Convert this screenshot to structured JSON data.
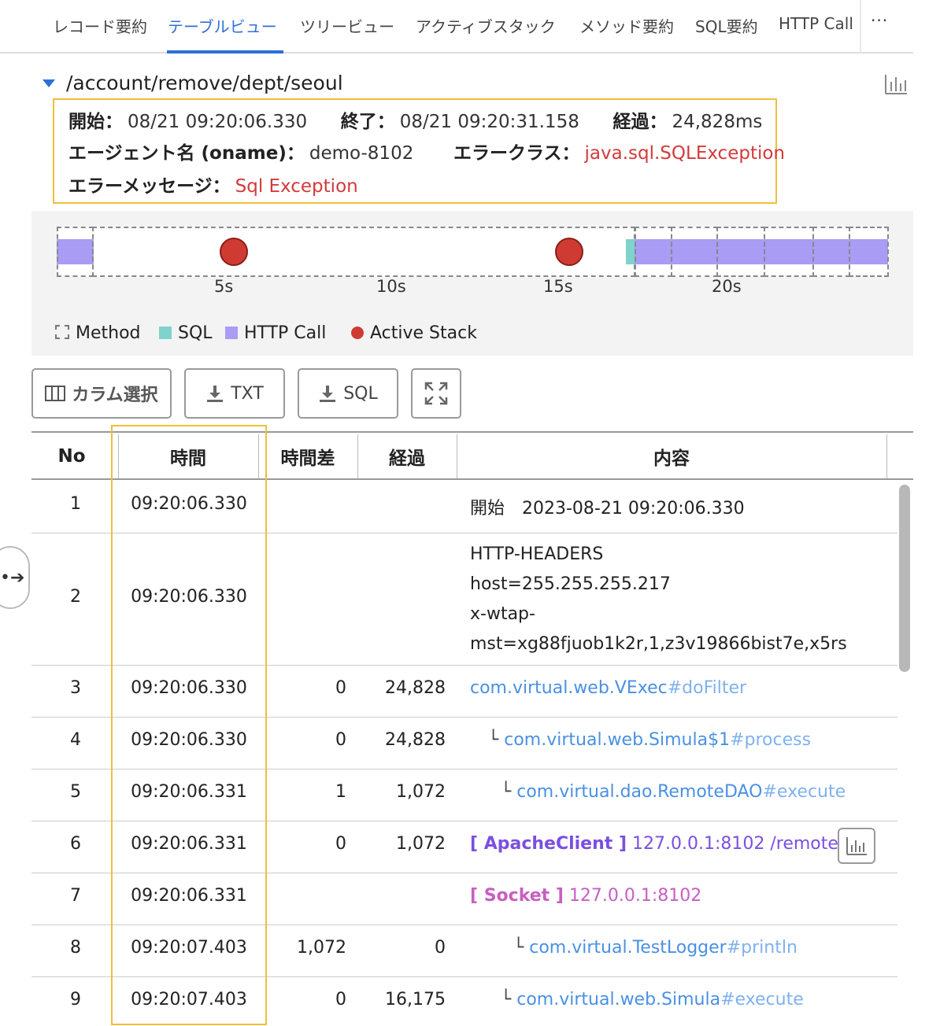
{
  "tabs": [
    {
      "label": "レコード要約",
      "active": false
    },
    {
      "label": "テーブルビュー",
      "active": true
    },
    {
      "label": "ツリービュー",
      "active": false
    },
    {
      "label": "アクティブスタック",
      "active": false
    },
    {
      "label": "メソッド要約",
      "active": false
    },
    {
      "label": "SQL要約",
      "active": false
    },
    {
      "label": "HTTP Call",
      "active": false
    }
  ],
  "tabs_more": "···",
  "header": {
    "path": "/account/remove/dept/seoul"
  },
  "summary": {
    "start_label": "開始：",
    "start_value": "08/21 09:20:06.330",
    "end_label": "終了：",
    "end_value": "08/21 09:20:31.158",
    "elapsed_label": "経過：",
    "elapsed_value": "24,828ms",
    "agent_label": "エージェント名 (oname)：",
    "agent_value": "demo-8102",
    "error_class_label": "エラークラス：",
    "error_class_value": "java.sql.SQLException",
    "error_message_label": "エラーメッセージ：",
    "error_message_value": "Sql Exception"
  },
  "timeline": {
    "ticks": [
      "5s",
      "10s",
      "15s",
      "20s"
    ],
    "legend": {
      "method": "Method",
      "sql": "SQL",
      "http": "HTTP Call",
      "active_stack": "Active Stack"
    },
    "colors": {
      "http": "#a99cf5",
      "sql": "#7fd3cc",
      "active_stack": "#cf3b33"
    }
  },
  "toolbar": {
    "column_select": "カラム選択",
    "txt": "TXT",
    "sql": "SQL"
  },
  "table": {
    "headers": {
      "no": "No",
      "time": "時間",
      "diff": "時間差",
      "elapsed": "経過",
      "content": "内容"
    },
    "rows": [
      {
        "no": "1",
        "time": "09:20:06.330",
        "diff": "",
        "elapsed": "",
        "content": "開始　2023-08-21 09:20:06.330"
      },
      {
        "no": "2",
        "time": "09:20:06.330",
        "diff": "",
        "elapsed": "",
        "lines": [
          "HTTP-HEADERS",
          "host=255.255.255.217",
          "x-wtap-",
          "mst=xg88fjuob1k2r,1,z3v19866bist7e,x5rs"
        ]
      },
      {
        "no": "3",
        "time": "09:20:06.330",
        "diff": "0",
        "elapsed": "24,828",
        "prefix": "",
        "cls": "com.virtual.web.VExec",
        "method": "#doFilter"
      },
      {
        "no": "4",
        "time": "09:20:06.330",
        "diff": "0",
        "elapsed": "24,828",
        "prefix": "└ ",
        "cls": "com.virtual.web.Simula$1",
        "method": "#process"
      },
      {
        "no": "5",
        "time": "09:20:06.331",
        "diff": "1",
        "elapsed": "1,072",
        "prefix": "└ ",
        "cls": "com.virtual.dao.RemoteDAO",
        "method": "#execute"
      },
      {
        "no": "6",
        "time": "09:20:06.331",
        "diff": "0",
        "elapsed": "1,072",
        "tag": "[ ApacheClient ]",
        "text": "127.0.0.1:8102 /remote/..."
      },
      {
        "no": "7",
        "time": "09:20:06.331",
        "diff": "",
        "elapsed": "",
        "tag": "[ Socket ]",
        "text": "127.0.0.1:8102"
      },
      {
        "no": "8",
        "time": "09:20:07.403",
        "diff": "1,072",
        "elapsed": "0",
        "prefix": "└ ",
        "cls": "com.virtual.TestLogger",
        "method": "#println"
      },
      {
        "no": "9",
        "time": "09:20:07.403",
        "diff": "0",
        "elapsed": "16,175",
        "prefix": "└ ",
        "cls": "com.virtual.web.Simula",
        "method": "#execute"
      }
    ]
  }
}
